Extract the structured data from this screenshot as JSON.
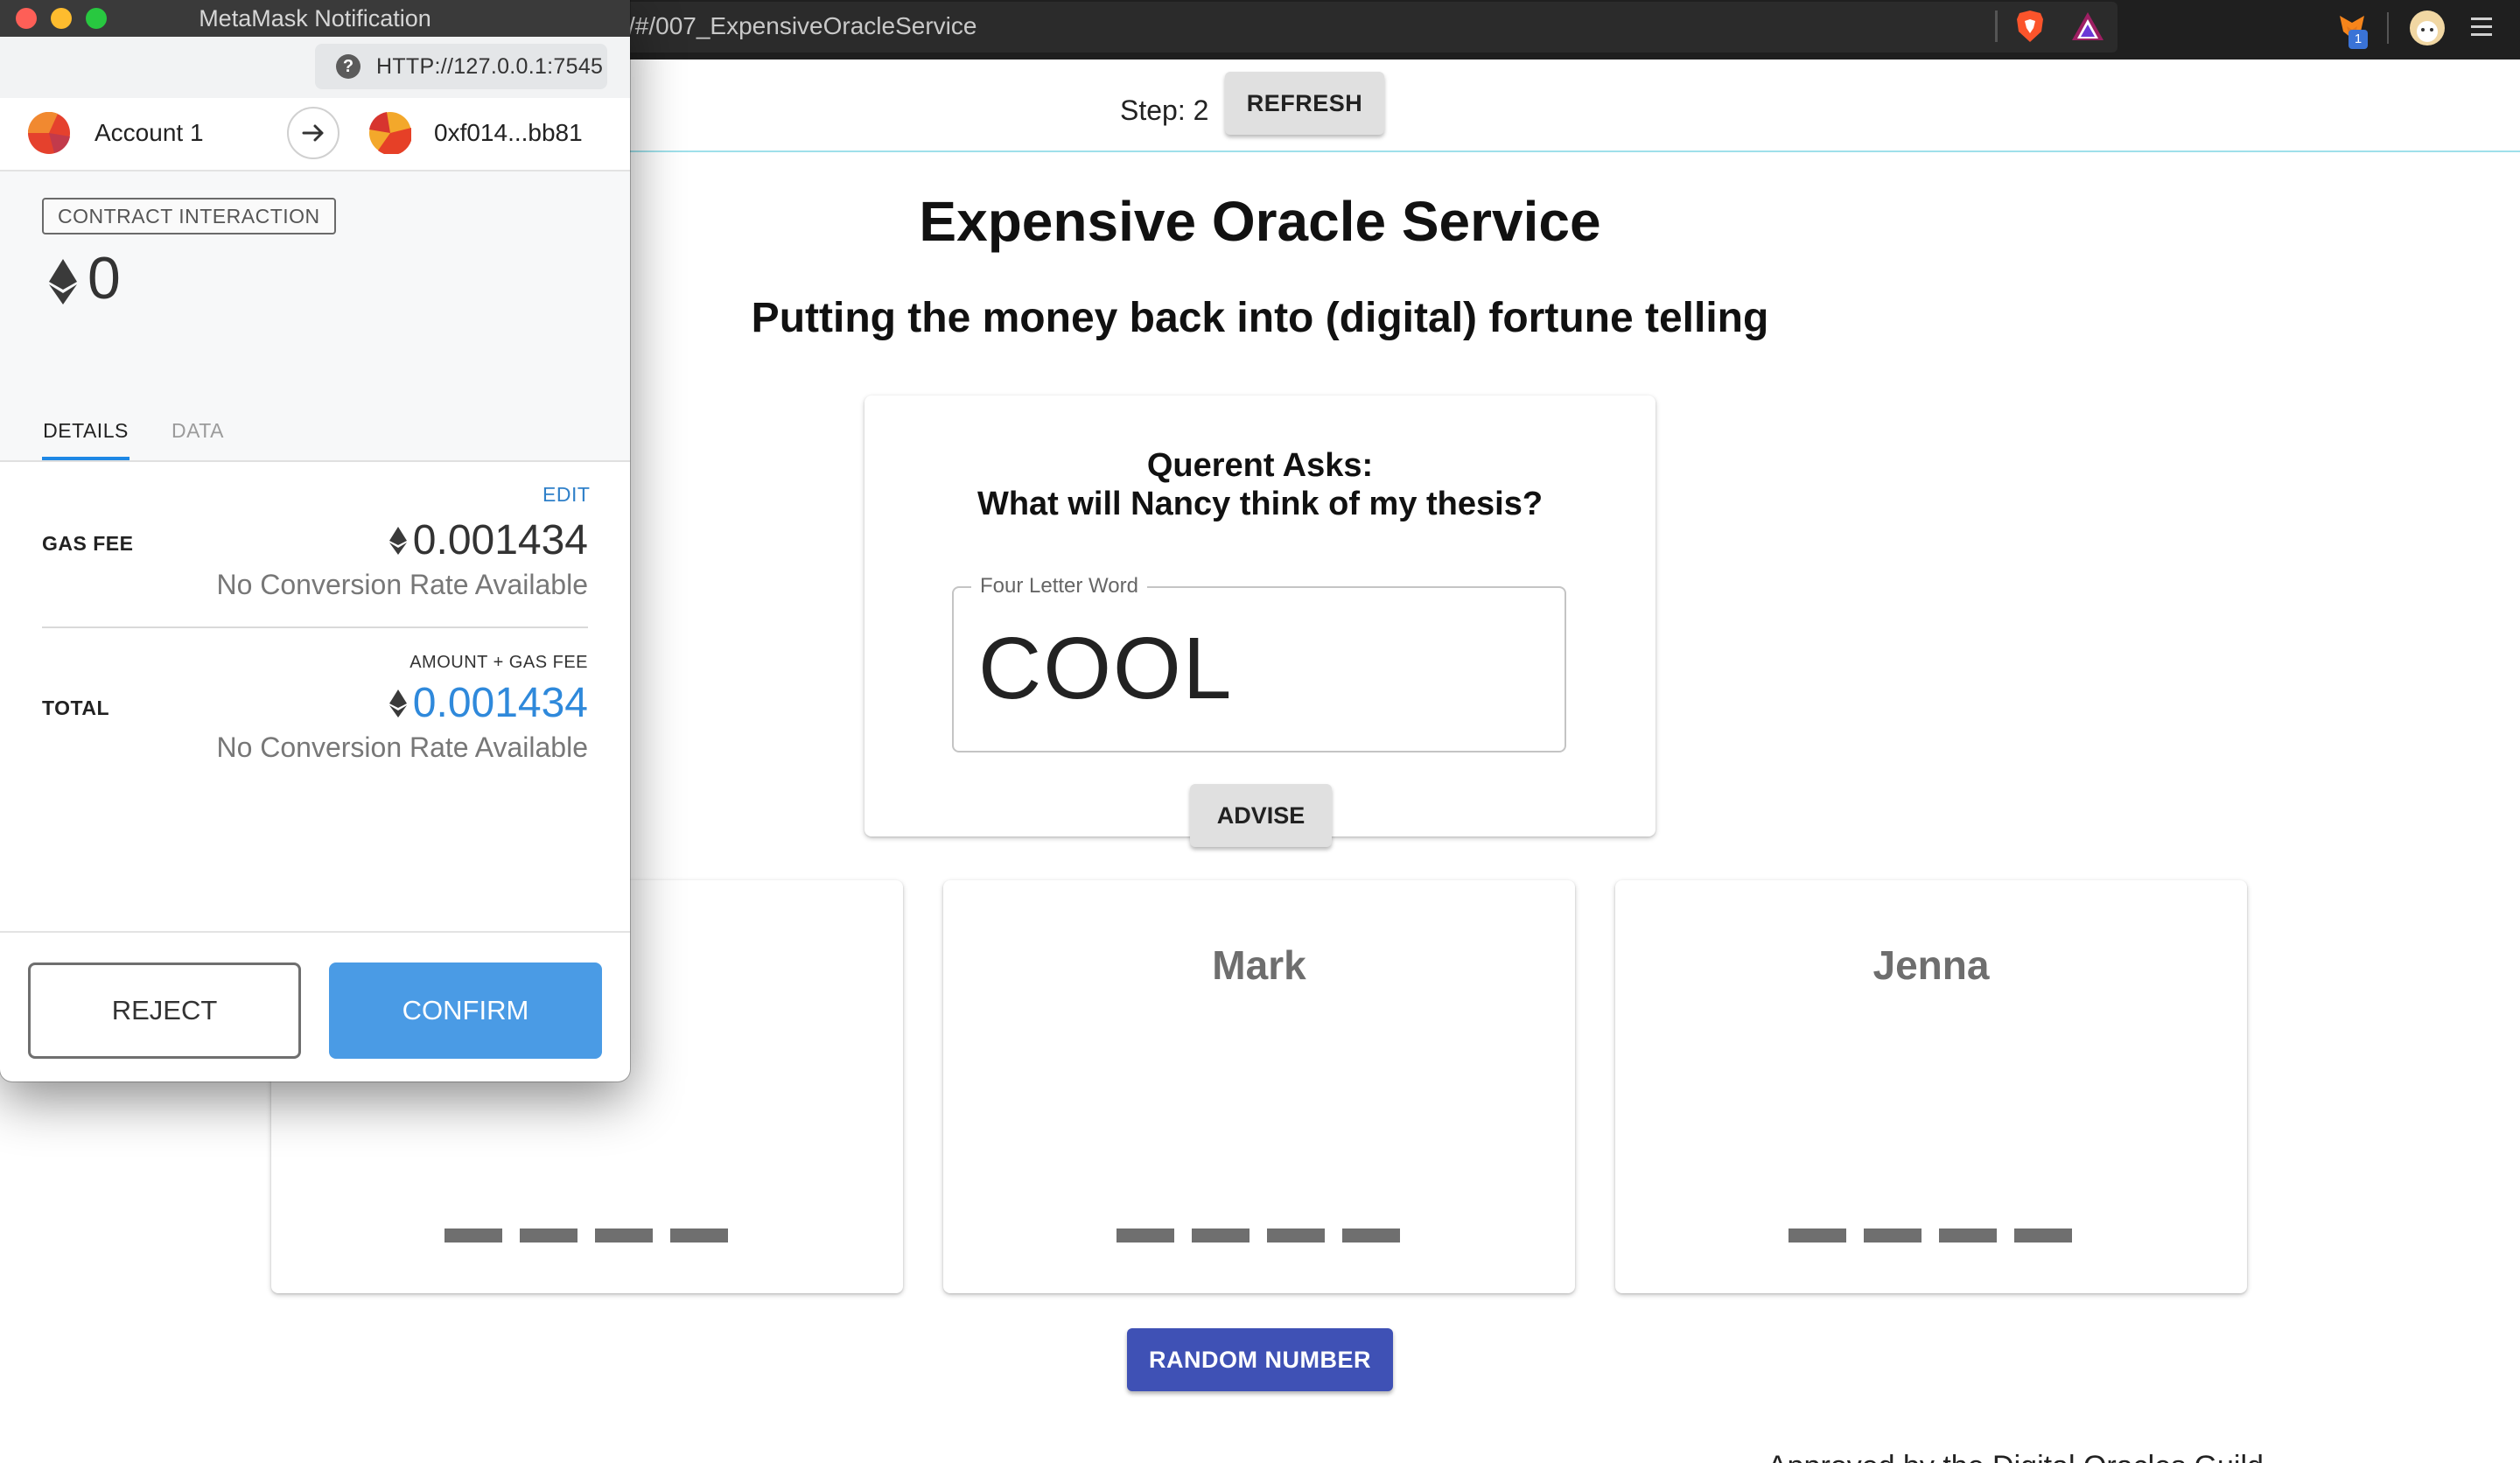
{
  "browser": {
    "url": "/#/007_ExpensiveOracleService",
    "extension_badge": "1"
  },
  "page": {
    "step_label": "Step: 2",
    "refresh_label": "REFRESH",
    "title": "Expensive Oracle Service",
    "subtitle": "Putting the money back into (digital) fortune telling",
    "question_card": {
      "heading": "Querent Asks:",
      "question": "What will Nancy think of my thesis?",
      "field_label": "Four Letter Word",
      "field_value": "COOL",
      "advise_label": "ADVISE"
    },
    "oracles": [
      {
        "name": "ny",
        "dashes": 4
      },
      {
        "name": "Mark",
        "dashes": 4
      },
      {
        "name": "Jenna",
        "dashes": 4
      }
    ],
    "random_number_label": "RANDOM NUMBER",
    "footer_text": "Approved by the Digital Oracles Guild"
  },
  "metamask": {
    "window_title": "MetaMask Notification",
    "origin": "HTTP://127.0.0.1:7545",
    "from_account": "Account 1",
    "to_account": "0xf014...bb81",
    "interaction_type": "CONTRACT INTERACTION",
    "amount": "0",
    "tabs": [
      "DETAILS",
      "DATA"
    ],
    "active_tab": "DETAILS",
    "edit_label": "EDIT",
    "gas_fee_label": "GAS FEE",
    "gas_fee_value": "0.001434",
    "gas_fee_conversion": "No Conversion Rate Available",
    "total_caption": "AMOUNT + GAS FEE",
    "total_label": "TOTAL",
    "total_value": "0.001434",
    "total_conversion": "No Conversion Rate Available",
    "reject_label": "REJECT",
    "confirm_label": "CONFIRM"
  },
  "colors": {
    "confirm_blue": "#4a9be5",
    "total_blue": "#2f89db",
    "random_button": "#3f51b5",
    "close_red": "#fe5f57",
    "minimize_yellow": "#febc2e",
    "zoom_green": "#28c840"
  }
}
